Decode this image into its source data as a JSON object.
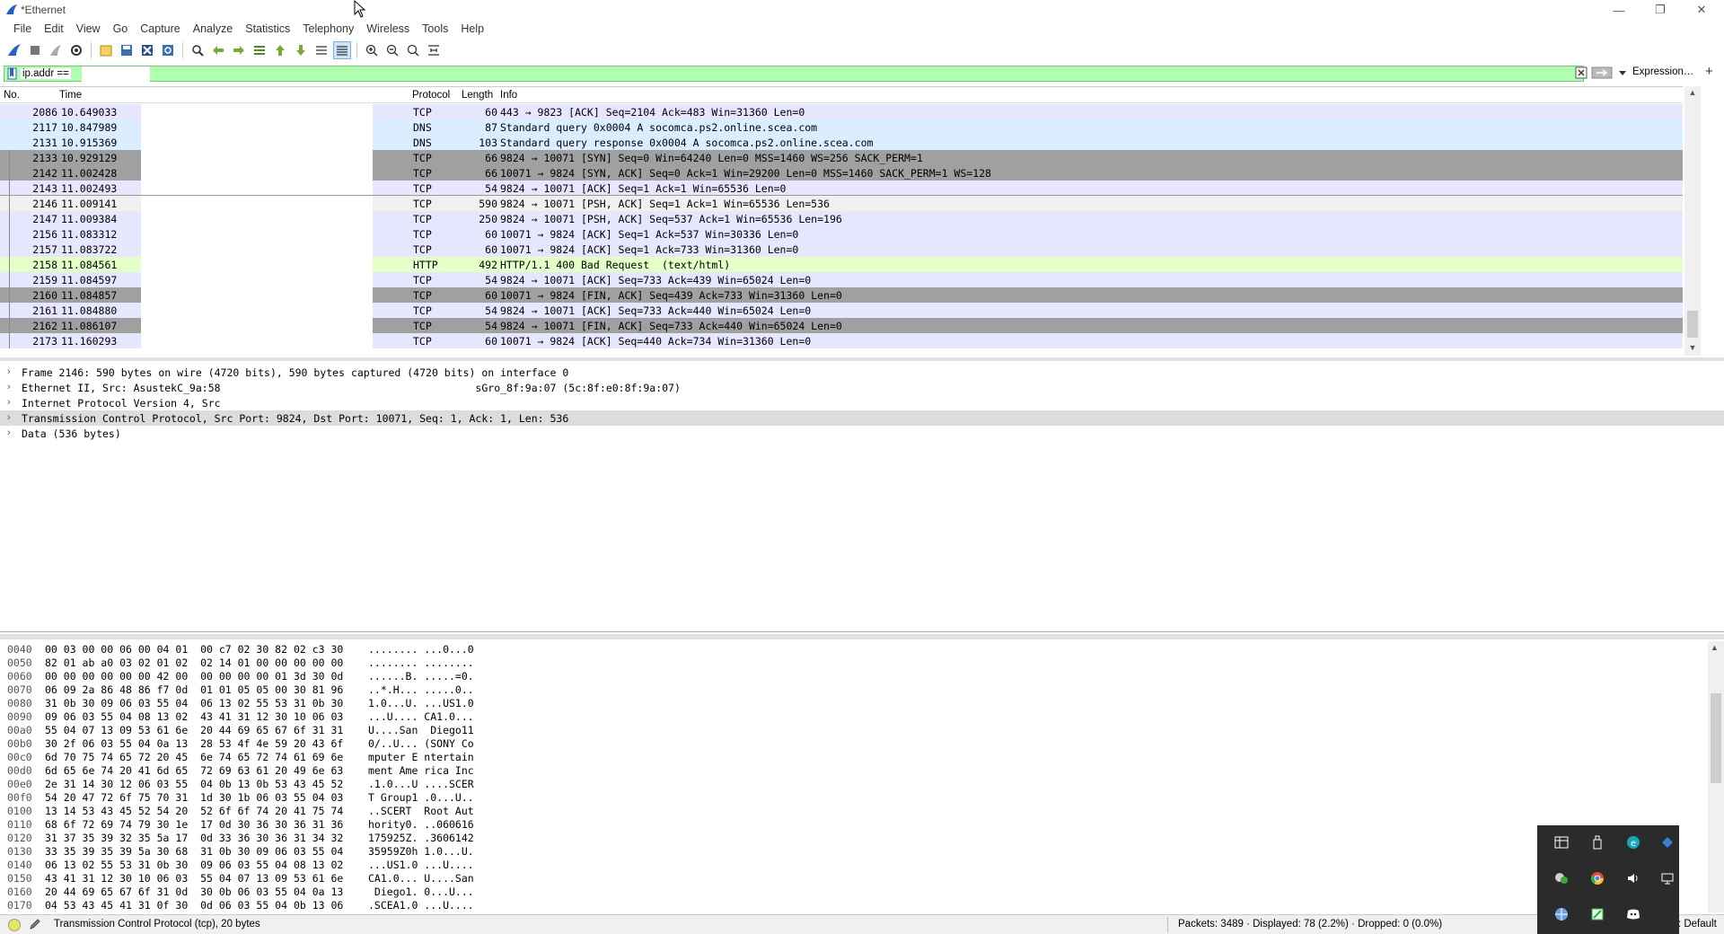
{
  "window": {
    "title": "*Ethernet",
    "minimize": "—",
    "restore": "❐",
    "close": "✕"
  },
  "menu": [
    "File",
    "Edit",
    "View",
    "Go",
    "Capture",
    "Analyze",
    "Statistics",
    "Telephony",
    "Wireless",
    "Tools",
    "Help"
  ],
  "toolbar_icons": [
    "start-capture-icon",
    "stop-capture-icon",
    "restart-capture-icon",
    "capture-options-icon",
    "open-file-icon",
    "save-file-icon",
    "close-file-icon",
    "reload-file-icon",
    "find-packet-icon",
    "go-back-icon",
    "go-forward-icon",
    "go-to-packet-icon",
    "go-first-icon",
    "go-last-icon",
    "auto-scroll-icon",
    "colorize-icon",
    "zoom-in-icon",
    "zoom-out-icon",
    "normal-size-icon",
    "resize-columns-icon"
  ],
  "filter": {
    "value": "ip.addr ==",
    "expression_label": "Expression…",
    "add_label": "+"
  },
  "packet_list": {
    "columns": {
      "no": "No.",
      "time": "Time",
      "protocol": "Protocol",
      "length": "Length",
      "info": "Info"
    },
    "rows": [
      {
        "no": "2086",
        "time": "10.649033",
        "protocol": "TCP",
        "length": "60",
        "info": "443 → 9823 [ACK] Seq=2104 Ack=483 Win=31360 Len=0",
        "style": "tcp"
      },
      {
        "no": "2117",
        "time": "10.847989",
        "protocol": "DNS",
        "length": "87",
        "info": "Standard query 0x0004 A socomca.ps2.online.scea.com",
        "style": "dns"
      },
      {
        "no": "2131",
        "time": "10.915369",
        "protocol": "DNS",
        "length": "103",
        "info": "Standard query response 0x0004 A socomca.ps2.online.scea.com",
        "style": "dns"
      },
      {
        "no": "2133",
        "time": "10.929129",
        "protocol": "TCP",
        "length": "66",
        "info": "9824 → 10071 [SYN] Seq=0 Win=64240 Len=0 MSS=1460 WS=256 SACK_PERM=1",
        "style": "syn"
      },
      {
        "no": "2142",
        "time": "11.002428",
        "protocol": "TCP",
        "length": "66",
        "info": "10071 → 9824 [SYN, ACK] Seq=0 Ack=1 Win=29200 Len=0 MSS=1460 SACK_PERM=1 WS=128",
        "style": "syn"
      },
      {
        "no": "2143",
        "time": "11.002493",
        "protocol": "TCP",
        "length": "54",
        "info": "9824 → 10071 [ACK] Seq=1 Ack=1 Win=65536 Len=0",
        "style": "tcp"
      },
      {
        "no": "2146",
        "time": "11.009141",
        "protocol": "TCP",
        "length": "590",
        "info": "9824 → 10071 [PSH, ACK] Seq=1 Ack=1 Win=65536 Len=536",
        "style": "selected"
      },
      {
        "no": "2147",
        "time": "11.009384",
        "protocol": "TCP",
        "length": "250",
        "info": "9824 → 10071 [PSH, ACK] Seq=537 Ack=1 Win=65536 Len=196",
        "style": "tcp"
      },
      {
        "no": "2156",
        "time": "11.083312",
        "protocol": "TCP",
        "length": "60",
        "info": "10071 → 9824 [ACK] Seq=1 Ack=537 Win=30336 Len=0",
        "style": "tcp"
      },
      {
        "no": "2157",
        "time": "11.083722",
        "protocol": "TCP",
        "length": "60",
        "info": "10071 → 9824 [ACK] Seq=1 Ack=733 Win=31360 Len=0",
        "style": "tcp"
      },
      {
        "no": "2158",
        "time": "11.084561",
        "protocol": "HTTP",
        "length": "492",
        "info": "HTTP/1.1 400 Bad Request  (text/html)",
        "style": "http"
      },
      {
        "no": "2159",
        "time": "11.084597",
        "protocol": "TCP",
        "length": "54",
        "info": "9824 → 10071 [ACK] Seq=733 Ack=439 Win=65024 Len=0",
        "style": "tcp"
      },
      {
        "no": "2160",
        "time": "11.084857",
        "protocol": "TCP",
        "length": "60",
        "info": "10071 → 9824 [FIN, ACK] Seq=439 Ack=733 Win=31360 Len=0",
        "style": "syn"
      },
      {
        "no": "2161",
        "time": "11.084880",
        "protocol": "TCP",
        "length": "54",
        "info": "9824 → 10071 [ACK] Seq=733 Ack=440 Win=65024 Len=0",
        "style": "tcp"
      },
      {
        "no": "2162",
        "time": "11.086107",
        "protocol": "TCP",
        "length": "54",
        "info": "9824 → 10071 [FIN, ACK] Seq=733 Ack=440 Win=65024 Len=0",
        "style": "syn"
      },
      {
        "no": "2173",
        "time": "11.160293",
        "protocol": "TCP",
        "length": "60",
        "info": "10071 → 9824 [ACK] Seq=440 Ack=734 Win=31360 Len=0",
        "style": "tcp"
      }
    ]
  },
  "details": [
    {
      "text": "Frame 2146: 590 bytes on wire (4720 bits), 590 bytes captured (4720 bits) on interface 0",
      "selected": false
    },
    {
      "text": "Ethernet II, Src: AsustekC_9a:58                                         sGro_8f:9a:07 (5c:8f:e0:8f:9a:07)",
      "selected": false
    },
    {
      "text": "Internet Protocol Version 4, Src",
      "selected": false
    },
    {
      "text": "Transmission Control Protocol, Src Port: 9824, Dst Port: 10071, Seq: 1, Ack: 1, Len: 536",
      "selected": true
    },
    {
      "text": "Data (536 bytes)",
      "selected": false
    }
  ],
  "bytes": [
    {
      "off": "0040",
      "hex": "00 03 00 00 06 00 04 01  00 c7 02 30 82 02 c3 30",
      "asc": "........ ...0...0"
    },
    {
      "off": "0050",
      "hex": "82 01 ab a0 03 02 01 02  02 14 01 00 00 00 00 00",
      "asc": "........ ........"
    },
    {
      "off": "0060",
      "hex": "00 00 00 00 00 00 42 00  00 00 00 00 01 3d 30 0d",
      "asc": "......B. .....=0."
    },
    {
      "off": "0070",
      "hex": "06 09 2a 86 48 86 f7 0d  01 01 05 05 00 30 81 96",
      "asc": "..*.H... .....0.."
    },
    {
      "off": "0080",
      "hex": "31 0b 30 09 06 03 55 04  06 13 02 55 53 31 0b 30",
      "asc": "1.0...U. ...US1.0"
    },
    {
      "off": "0090",
      "hex": "09 06 03 55 04 08 13 02  43 41 31 12 30 10 06 03",
      "asc": "...U.... CA1.0..."
    },
    {
      "off": "00a0",
      "hex": "55 04 07 13 09 53 61 6e  20 44 69 65 67 6f 31 31",
      "asc": "U....San  Diego11"
    },
    {
      "off": "00b0",
      "hex": "30 2f 06 03 55 04 0a 13  28 53 4f 4e 59 20 43 6f",
      "asc": "0/..U... (SONY Co"
    },
    {
      "off": "00c0",
      "hex": "6d 70 75 74 65 72 20 45  6e 74 65 72 74 61 69 6e",
      "asc": "mputer E ntertain"
    },
    {
      "off": "00d0",
      "hex": "6d 65 6e 74 20 41 6d 65  72 69 63 61 20 49 6e 63",
      "asc": "ment Ame rica Inc"
    },
    {
      "off": "00e0",
      "hex": "2e 31 14 30 12 06 03 55  04 0b 13 0b 53 43 45 52",
      "asc": ".1.0...U ....SCER"
    },
    {
      "off": "00f0",
      "hex": "54 20 47 72 6f 75 70 31  1d 30 1b 06 03 55 04 03",
      "asc": "T Group1 .0...U.."
    },
    {
      "off": "0100",
      "hex": "13 14 53 43 45 52 54 20  52 6f 6f 74 20 41 75 74",
      "asc": "..SCERT  Root Aut"
    },
    {
      "off": "0110",
      "hex": "68 6f 72 69 74 79 30 1e  17 0d 30 36 30 36 31 36",
      "asc": "hority0. ..060616"
    },
    {
      "off": "0120",
      "hex": "31 37 35 39 32 35 5a 17  0d 33 36 30 36 31 34 32",
      "asc": "175925Z. .3606142"
    },
    {
      "off": "0130",
      "hex": "33 35 39 35 39 5a 30 68  31 0b 30 09 06 03 55 04",
      "asc": "35959Z0h 1.0...U."
    },
    {
      "off": "0140",
      "hex": "06 13 02 55 53 31 0b 30  09 06 03 55 04 08 13 02",
      "asc": "...US1.0 ...U...."
    },
    {
      "off": "0150",
      "hex": "43 41 31 12 30 10 06 03  55 04 07 13 09 53 61 6e",
      "asc": "CA1.0... U....San"
    },
    {
      "off": "0160",
      "hex": "20 44 69 65 67 6f 31 0d  30 0b 06 03 55 04 0a 13",
      "asc": " Diego1. 0...U..."
    },
    {
      "off": "0170",
      "hex": "04 53 43 45 41 31 0f 30  0d 06 03 55 04 0b 13 06",
      "asc": ".SCEA1.0 ...U...."
    }
  ],
  "status": {
    "text": "Transmission Control Protocol (tcp), 20 bytes",
    "counts": "Packets: 3489 · Displayed: 78 (2.2%) · Dropped: 0 (0.0%)",
    "profile": "le: Default"
  },
  "tray_icons": [
    "grid-app-icon",
    "usb-device-icon",
    "browser-app-icon",
    "vpn-app-icon",
    "chat-app-icon",
    "chrome-icon",
    "speaker-icon",
    "display-icon",
    "network-globe-icon",
    "spreadsheet-app-icon",
    "discord-icon"
  ],
  "colors": {
    "tcp": "#e7e6ff",
    "dns": "#daeeff",
    "http": "#e4ffc7",
    "syn_fin": "#a0a0a0",
    "filter_ok": "#afffaf"
  }
}
